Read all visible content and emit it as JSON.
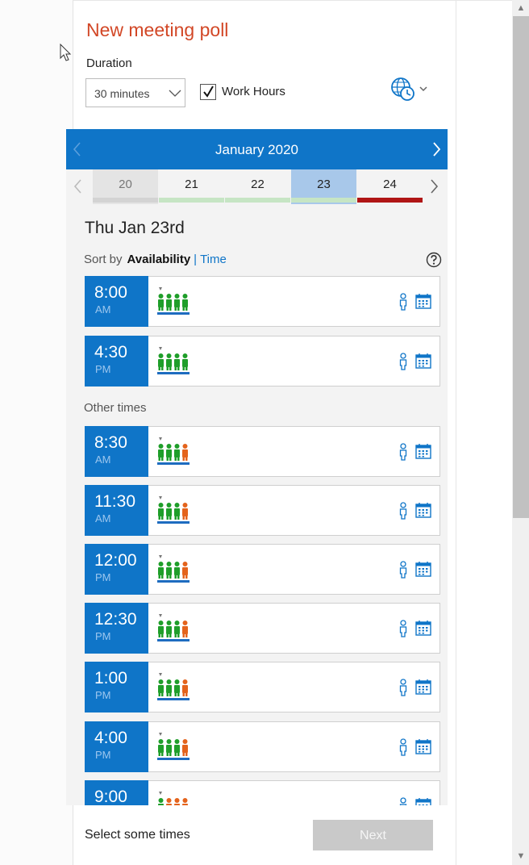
{
  "header": {
    "title": "New meeting poll"
  },
  "duration": {
    "label": "Duration",
    "value": "30 minutes"
  },
  "work_hours": {
    "label": "Work Hours",
    "checked": true
  },
  "calendar": {
    "month": "January 2020",
    "days": [
      {
        "num": "20",
        "status": "past"
      },
      {
        "num": "21",
        "status": "free"
      },
      {
        "num": "22",
        "status": "free"
      },
      {
        "num": "23",
        "status": "selected"
      },
      {
        "num": "24",
        "status": "busy"
      }
    ]
  },
  "day_view": {
    "heading": "Thu Jan 23rd",
    "sort_label": "Sort by",
    "sort_active": "Availability",
    "sort_sep": "|",
    "sort_other": "Time",
    "other_times_label": "Other times"
  },
  "slots": [
    {
      "time": "8:00",
      "ampm": "AM",
      "attendees": [
        "free",
        "free",
        "free",
        "free"
      ]
    },
    {
      "time": "4:30",
      "ampm": "PM",
      "attendees": [
        "free",
        "free",
        "free",
        "free"
      ]
    },
    {
      "time": "8:30",
      "ampm": "AM",
      "attendees": [
        "free",
        "free",
        "free",
        "busy"
      ]
    },
    {
      "time": "11:30",
      "ampm": "AM",
      "attendees": [
        "free",
        "free",
        "free",
        "busy"
      ]
    },
    {
      "time": "12:00",
      "ampm": "PM",
      "attendees": [
        "free",
        "free",
        "free",
        "busy"
      ]
    },
    {
      "time": "12:30",
      "ampm": "PM",
      "attendees": [
        "free",
        "free",
        "free",
        "busy"
      ]
    },
    {
      "time": "1:00",
      "ampm": "PM",
      "attendees": [
        "free",
        "free",
        "free",
        "busy"
      ]
    },
    {
      "time": "4:00",
      "ampm": "PM",
      "attendees": [
        "free",
        "free",
        "free",
        "busy"
      ]
    },
    {
      "time": "9:00",
      "ampm": "",
      "attendees": [
        "free",
        "busy",
        "busy",
        "busy"
      ]
    }
  ],
  "footer": {
    "text": "Select some times",
    "next_label": "Next"
  },
  "colors": {
    "accent": "#0f75c8",
    "title": "#d24726",
    "free": "#1f9e2a",
    "busy": "#e4631c",
    "day_free": "#c6e5c4",
    "day_busy": "#b01515",
    "day_selected": "#a8c8ea"
  }
}
